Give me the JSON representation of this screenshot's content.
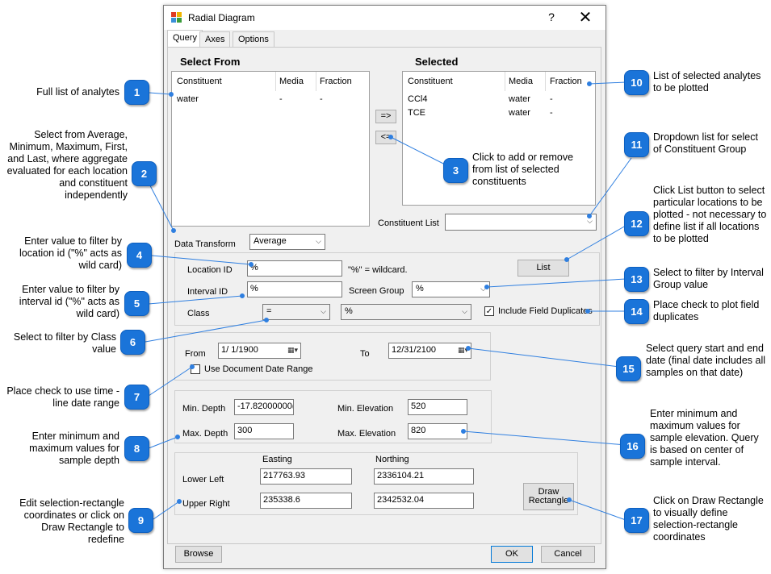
{
  "dialog": {
    "title": "Radial Diagram",
    "help": "?",
    "close": "✕",
    "tabs": [
      "Query",
      "Axes",
      "Options"
    ]
  },
  "query": {
    "select_from_heading": "Select From",
    "selected_heading": "Selected",
    "columns": [
      "Constituent",
      "Media",
      "Fraction"
    ],
    "select_from_rows": [
      {
        "constituent": "water",
        "media": "-",
        "fraction": "-"
      }
    ],
    "selected_rows": [
      {
        "constituent": "CCl4",
        "media": "water",
        "fraction": "-"
      },
      {
        "constituent": "TCE",
        "media": "water",
        "fraction": "-"
      }
    ],
    "add_button": "=>",
    "remove_button": "<=",
    "constituent_list_label": "Constituent List",
    "constituent_list_value": "",
    "data_transform_label": "Data Transform",
    "data_transform_value": "Average",
    "location_id_label": "Location ID",
    "location_id_value": "%",
    "wildcard_note": "\"%\" = wildcard.",
    "list_button": "List",
    "interval_id_label": "Interval ID",
    "interval_id_value": "%",
    "screen_group_label": "Screen Group",
    "screen_group_value": "%",
    "class_label": "Class",
    "class_operator": "=",
    "class_value": "%",
    "include_field_duplicates_label": "Include Field Duplicates",
    "include_field_duplicates_checked": true,
    "from_label": "From",
    "from_value": "1/  1/1900",
    "to_label": "To",
    "to_value": "12/31/2100",
    "use_doc_date_label": "Use Document Date Range",
    "use_doc_date_checked": false,
    "min_depth_label": "Min. Depth",
    "min_depth_value": "-17.82000000(",
    "max_depth_label": "Max. Depth",
    "max_depth_value": "300",
    "min_elev_label": "Min. Elevation",
    "min_elev_value": "520",
    "max_elev_label": "Max. Elevation",
    "max_elev_value": "820",
    "easting_label": "Easting",
    "northing_label": "Northing",
    "lower_left_label": "Lower Left",
    "lower_left_easting": "217763.93",
    "lower_left_northing": "2336104.21",
    "upper_right_label": "Upper Right",
    "upper_right_easting": "235338.6",
    "upper_right_northing": "2342532.04",
    "draw_rectangle_button": "Draw\nRectangle"
  },
  "footer": {
    "browse": "Browse",
    "ok": "OK",
    "cancel": "Cancel"
  },
  "callouts": [
    {
      "n": "1",
      "text": "Full list of analytes"
    },
    {
      "n": "2",
      "text": "Select from Average, Minimum, Maximum, First, and Last, where aggregate evaluated for each location and constituent independently"
    },
    {
      "n": "3",
      "text": "Click to add or remove from list of selected constituents"
    },
    {
      "n": "4",
      "text": "Enter value to filter by location id (\"%\" acts as wild card)"
    },
    {
      "n": "5",
      "text": "Enter value to filter by interval id (\"%\" acts as wild card)"
    },
    {
      "n": "6",
      "text": "Select to filter by Class value"
    },
    {
      "n": "7",
      "text": "Place check to use time -line date range"
    },
    {
      "n": "8",
      "text": "Enter minimum and maximum values for sample depth"
    },
    {
      "n": "9",
      "text": "Edit selection-rectangle coordinates or click on Draw Rectangle to redefine"
    },
    {
      "n": "10",
      "text": "List of selected analytes to be plotted"
    },
    {
      "n": "11",
      "text": "Dropdown list for select of Constituent Group"
    },
    {
      "n": "12",
      "text": "Click List button to select particular locations to be plotted - not necessary to define list if all locations to be plotted"
    },
    {
      "n": "13",
      "text": "Select to filter by Interval Group value"
    },
    {
      "n": "14",
      "text": "Place check to plot field duplicates"
    },
    {
      "n": "15",
      "text": "Select query start and end date (final date includes all samples on that date)"
    },
    {
      "n": "16",
      "text": "Enter minimum and maximum values for sample elevation. Query is based on center of sample interval."
    },
    {
      "n": "17",
      "text": "Click on Draw Rectangle to visually define selection-rectangle coordinates"
    }
  ],
  "colors": {
    "badge": "#1a74d9",
    "leader": "#2f7fe0",
    "dialog_bg": "#f0f0f0"
  }
}
